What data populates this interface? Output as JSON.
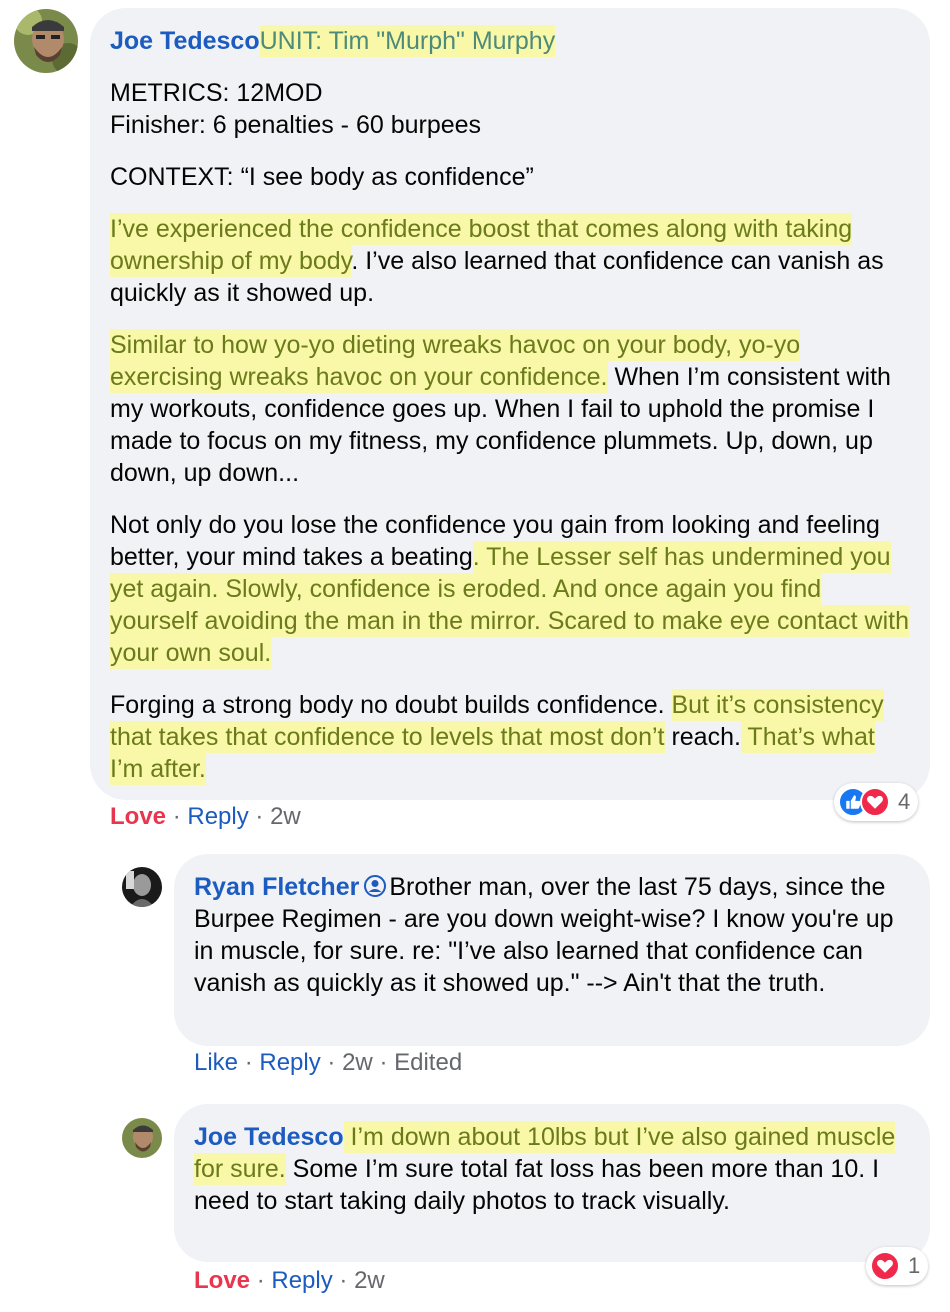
{
  "comments": [
    {
      "author": "Joe Tedesco",
      "title_highlight": "UNIT: Tim \"Murph\" Murphy",
      "metrics": "METRICS: 12MOD",
      "finisher": "Finisher: 6 penalties - 60 burpees",
      "context": "CONTEXT: “I see body as confidence”",
      "p1_hl": "I’ve experienced the confidence boost that comes along with taking ownership of my body",
      "p1_rest": ". I’ve also learned that confidence can vanish as quickly as it showed up.",
      "p2_hl": "Similar to how yo-yo dieting wreaks havoc on your body, yo-yo exercising wreaks havoc on your confidence.",
      "p2_rest": " When I’m consistent with my workouts, confidence goes up. When I fail to uphold the promise I made to focus on my fitness, my confidence plummets. Up, down, up down, up down...",
      "p3_plain": "Not only do you lose the confidence you gain from looking and feeling better, your mind takes a beating",
      "p3_hl": ". The Lesser self has undermined you yet again. Slowly, confidence is eroded. And once again you find yourself avoiding the man in the mirror. Scared to make eye contact with your own soul.",
      "p4_plain": "Forging a strong body no doubt builds confidence. ",
      "p4_hl1": "But it’s consistency that takes that confidence to levels that most don’t",
      "p4_mid": " reach.",
      "p4_hl2": " That’s what I’m after.",
      "action_love": "Love",
      "action_reply": "Reply",
      "time": "2w",
      "reaction_count": "4"
    },
    {
      "author": "Ryan Fletcher",
      "text": "Brother man, over the last 75 days, since the Burpee Regimen - are you down weight-wise? I know you're up in muscle, for sure. re: \"I’ve also learned that confidence can vanish as quickly as it showed up.\" --> Ain't that the truth.",
      "action_like": "Like",
      "action_reply": "Reply",
      "time": "2w",
      "edited": "Edited"
    },
    {
      "author": "Joe Tedesco",
      "text_hl": " I’m down about 10lbs but I’ve also gained muscle for sure.",
      "text_rest": " Some I’m sure total fat loss has been more than 10. I need to start taking daily photos to track visually.",
      "action_love": "Love",
      "action_reply": "Reply",
      "time": "2w",
      "reaction_count": "1"
    }
  ],
  "separator": "·",
  "colors": {
    "bubble": "#f0f2f5",
    "link": "#1c5bbf",
    "love": "#e8364f",
    "highlight": "#f8f8a8",
    "muted": "#65676b"
  },
  "icons": [
    "like-icon",
    "love-icon",
    "follower-icon"
  ]
}
